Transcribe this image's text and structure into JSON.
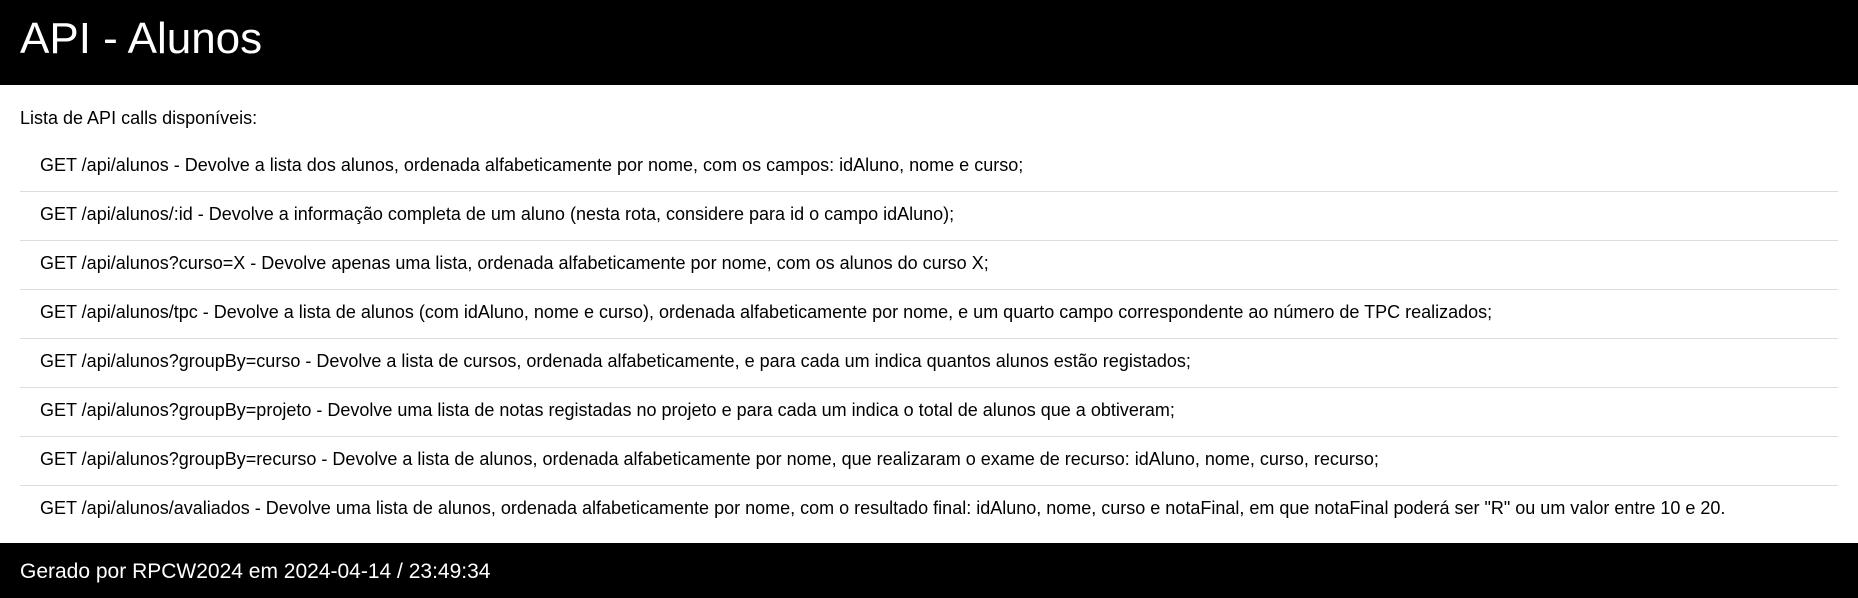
{
  "header": {
    "title": "API - Alunos"
  },
  "main": {
    "intro": "Lista de API calls disponíveis:",
    "api_calls": [
      "GET /api/alunos - Devolve a lista dos alunos, ordenada alfabeticamente por nome, com os campos: idAluno, nome e curso;",
      "GET /api/alunos/:id - Devolve a informação completa de um aluno (nesta rota, considere para id o campo idAluno);",
      "GET /api/alunos?curso=X - Devolve apenas uma lista, ordenada alfabeticamente por nome, com os alunos do curso X;",
      "GET /api/alunos/tpc - Devolve a lista de alunos (com idAluno, nome e curso), ordenada alfabeticamente por nome, e um quarto campo correspondente ao número de TPC realizados;",
      "GET /api/alunos?groupBy=curso - Devolve a lista de cursos, ordenada alfabeticamente, e para cada um indica quantos alunos estão registados;",
      "GET /api/alunos?groupBy=projeto - Devolve uma lista de notas registadas no projeto e para cada um indica o total de alunos que a obtiveram;",
      "GET /api/alunos?groupBy=recurso - Devolve a lista de alunos, ordenada alfabeticamente por nome, que realizaram o exame de recurso: idAluno, nome, curso, recurso;",
      "GET /api/alunos/avaliados - Devolve uma lista de alunos, ordenada alfabeticamente por nome, com o resultado final: idAluno, nome, curso e notaFinal, em que notaFinal poderá ser \"R\" ou um valor entre 10 e 20."
    ]
  },
  "footer": {
    "text": "Gerado por RPCW2024 em 2024-04-14 / 23:49:34"
  }
}
